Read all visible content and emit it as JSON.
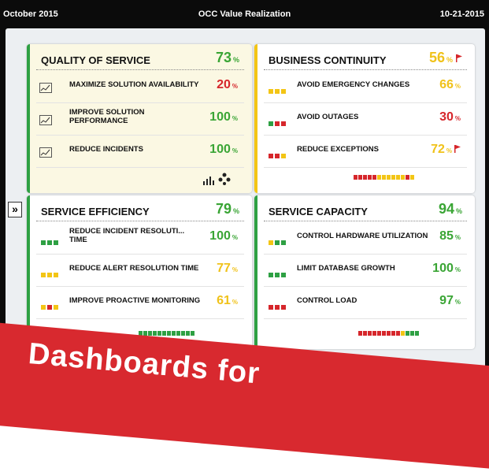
{
  "header": {
    "date": "October 2015",
    "title": "OCC Value Realization",
    "date_right": "10-21-2015"
  },
  "colors": {
    "green": "#2ea043",
    "yellow": "#f3c515",
    "red": "#d6262b",
    "green_text": "#3aa535",
    "yellow_text": "#f0c21a",
    "red_text": "#d6262b"
  },
  "collapse_icon": "double-chevron-right",
  "cards": {
    "quality": {
      "title": "QUALITY OF SERVICE",
      "score": "73",
      "pct": "%",
      "rows": [
        {
          "label": "MAXIMIZE SOLUTION AVAILABILITY",
          "value": "20",
          "pct": "%"
        },
        {
          "label": "IMPROVE SOLUTION PERFORMANCE",
          "value": "100",
          "pct": "%"
        },
        {
          "label": "REDUCE INCIDENTS",
          "value": "100",
          "pct": "%"
        }
      ],
      "footer_icons": [
        "bar-chart-icon",
        "network-icon"
      ]
    },
    "continuity": {
      "title": "BUSINESS CONTINUITY",
      "score": "56",
      "pct": "%",
      "rows": [
        {
          "label": "AVOID EMERGENCY CHANGES",
          "value": "66",
          "pct": "%"
        },
        {
          "label": "AVOID OUTAGES",
          "value": "30",
          "pct": "%"
        },
        {
          "label": "REDUCE EXCEPTIONS",
          "value": "72",
          "pct": "%"
        }
      ]
    },
    "efficiency": {
      "title": "SERVICE EFFICIENCY",
      "score": "79",
      "pct": "%",
      "rows": [
        {
          "label": "REDUCE INCIDENT RESOLUTI... TIME",
          "value": "100",
          "pct": "%"
        },
        {
          "label": "REDUCE ALERT RESOLUTION TIME",
          "value": "77",
          "pct": "%"
        },
        {
          "label": "IMPROVE PROACTIVE MONITORING",
          "value": "61",
          "pct": "%"
        }
      ]
    },
    "capacity": {
      "title": "SERVICE CAPACITY",
      "score": "94",
      "pct": "%",
      "rows": [
        {
          "label": "CONTROL HARDWARE UTILIZATION",
          "value": "85",
          "pct": "%"
        },
        {
          "label": "LIMIT DATABASE GROWTH",
          "value": "100",
          "pct": "%"
        },
        {
          "label": "CONTROL LOAD",
          "value": "97",
          "pct": "%"
        }
      ]
    }
  },
  "banner": {
    "text": "Dashboards for"
  }
}
